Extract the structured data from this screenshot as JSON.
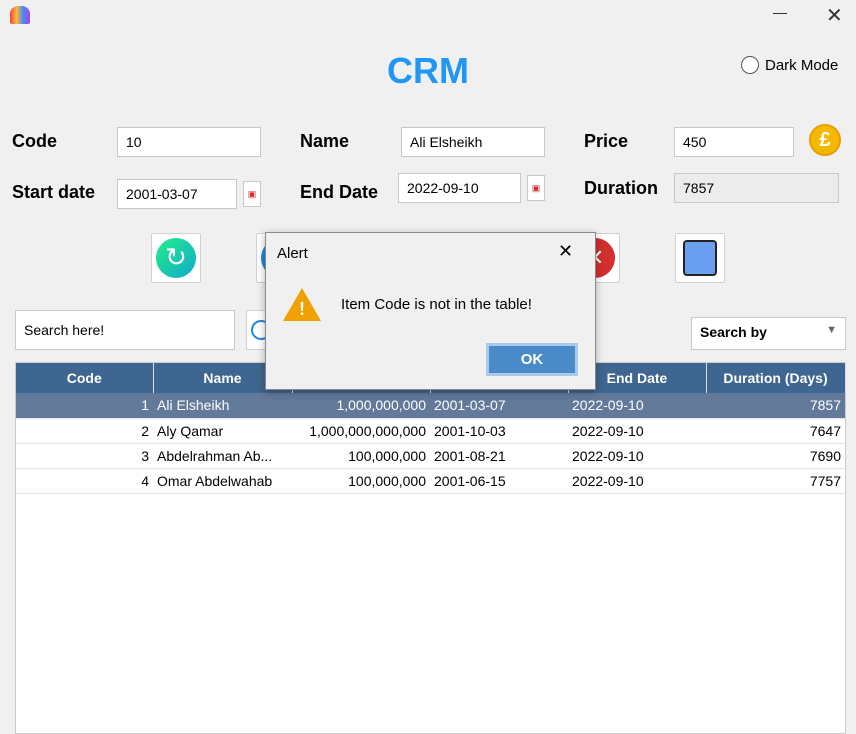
{
  "app": {
    "title": "CRM",
    "dark_mode": "Dark Mode"
  },
  "form": {
    "code_label": "Code",
    "code_value": "10",
    "name_label": "Name",
    "name_value": "Ali Elsheikh",
    "price_label": "Price",
    "price_value": "450",
    "start_label": "Start date",
    "start_value": "2001-03-07",
    "end_label": "End Date",
    "end_value": "2022-09-10",
    "duration_label": "Duration",
    "duration_value": "7857"
  },
  "search": {
    "placeholder": "Search here!",
    "search_by": "Search by"
  },
  "table": {
    "headers": {
      "code": "Code",
      "name": "Name",
      "end": "End Date",
      "duration": "Duration (Days)"
    },
    "rows": [
      {
        "code": "1",
        "name": "Ali Elsheikh",
        "price": "1,000,000,000",
        "start": "2001-03-07",
        "end": "2022-09-10",
        "duration": "7857"
      },
      {
        "code": "2",
        "name": "Aly Qamar",
        "price": "1,000,000,000,000",
        "start": "2001-10-03",
        "end": "2022-09-10",
        "duration": "7647"
      },
      {
        "code": "3",
        "name": "Abdelrahman Ab...",
        "price": "100,000,000",
        "start": "2001-08-21",
        "end": "2022-09-10",
        "duration": "7690"
      },
      {
        "code": "4",
        "name": "Omar Abdelwahab",
        "price": "100,000,000",
        "start": "2001-06-15",
        "end": "2022-09-10",
        "duration": "7757"
      }
    ]
  },
  "dialog": {
    "title": "Alert",
    "message": "Item Code is not in the table!",
    "ok": "OK"
  }
}
